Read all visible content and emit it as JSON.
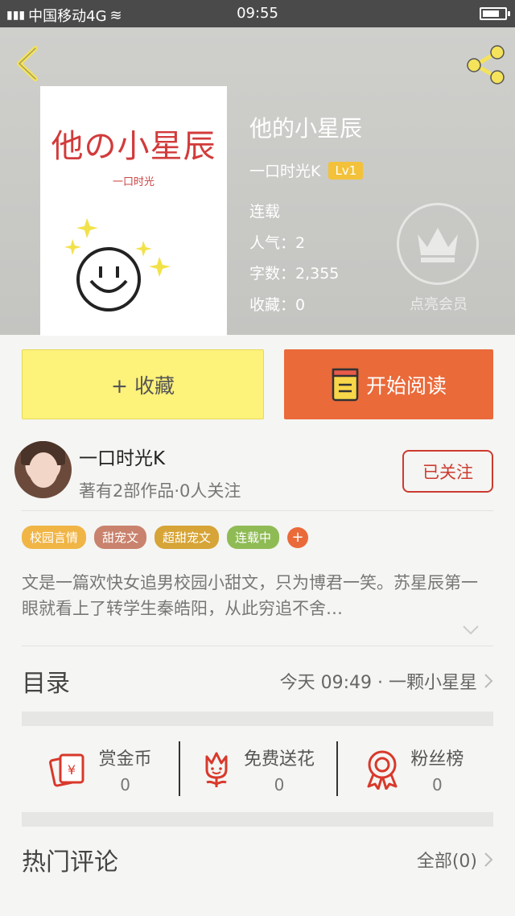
{
  "status_bar": {
    "carrier": "中国移动4G",
    "time": "09:55"
  },
  "cover": {
    "title": "他の小星辰",
    "author": "一口时光"
  },
  "book": {
    "title": "他的小星辰",
    "author": "一口时光K",
    "level": "Lv1",
    "status": "连载",
    "popularity": "人气：2",
    "word_count": "字数：2,355",
    "favorites": "收藏：0",
    "vip_label": "点亮会员"
  },
  "actions": {
    "collect_label": "+ 收藏",
    "read_label": "开始阅读"
  },
  "author_card": {
    "name": "一口时光K",
    "sub": "著有2部作品·0人关注",
    "follow_label": "已关注"
  },
  "tags": [
    {
      "label": "校园言情",
      "color": "#f0b545"
    },
    {
      "label": "甜宠文",
      "color": "#c9826d"
    },
    {
      "label": "超甜宠文",
      "color": "#d6a437"
    },
    {
      "label": "连载中",
      "color": "#8fbb55"
    }
  ],
  "tag_add": "+",
  "description": "文是一篇欢快女追男校园小甜文，只为博君一笑。苏星辰第一眼就看上了转学生秦皓阳，从此穷追不舍…",
  "catalog": {
    "title": "目录",
    "latest": "今天 09:49 · 一颗小星星"
  },
  "stats": [
    {
      "label": "赏金币",
      "count": "0",
      "icon": "red-envelope-icon"
    },
    {
      "label": "免费送花",
      "count": "0",
      "icon": "flower-icon"
    },
    {
      "label": "粉丝榜",
      "count": "0",
      "icon": "medal-icon"
    }
  ],
  "comments": {
    "title": "热门评论",
    "all_label": "全部(0)"
  },
  "colors": {
    "accent": "#ea6a3a",
    "collect": "#fdf27a",
    "follow": "#cc3b30"
  }
}
